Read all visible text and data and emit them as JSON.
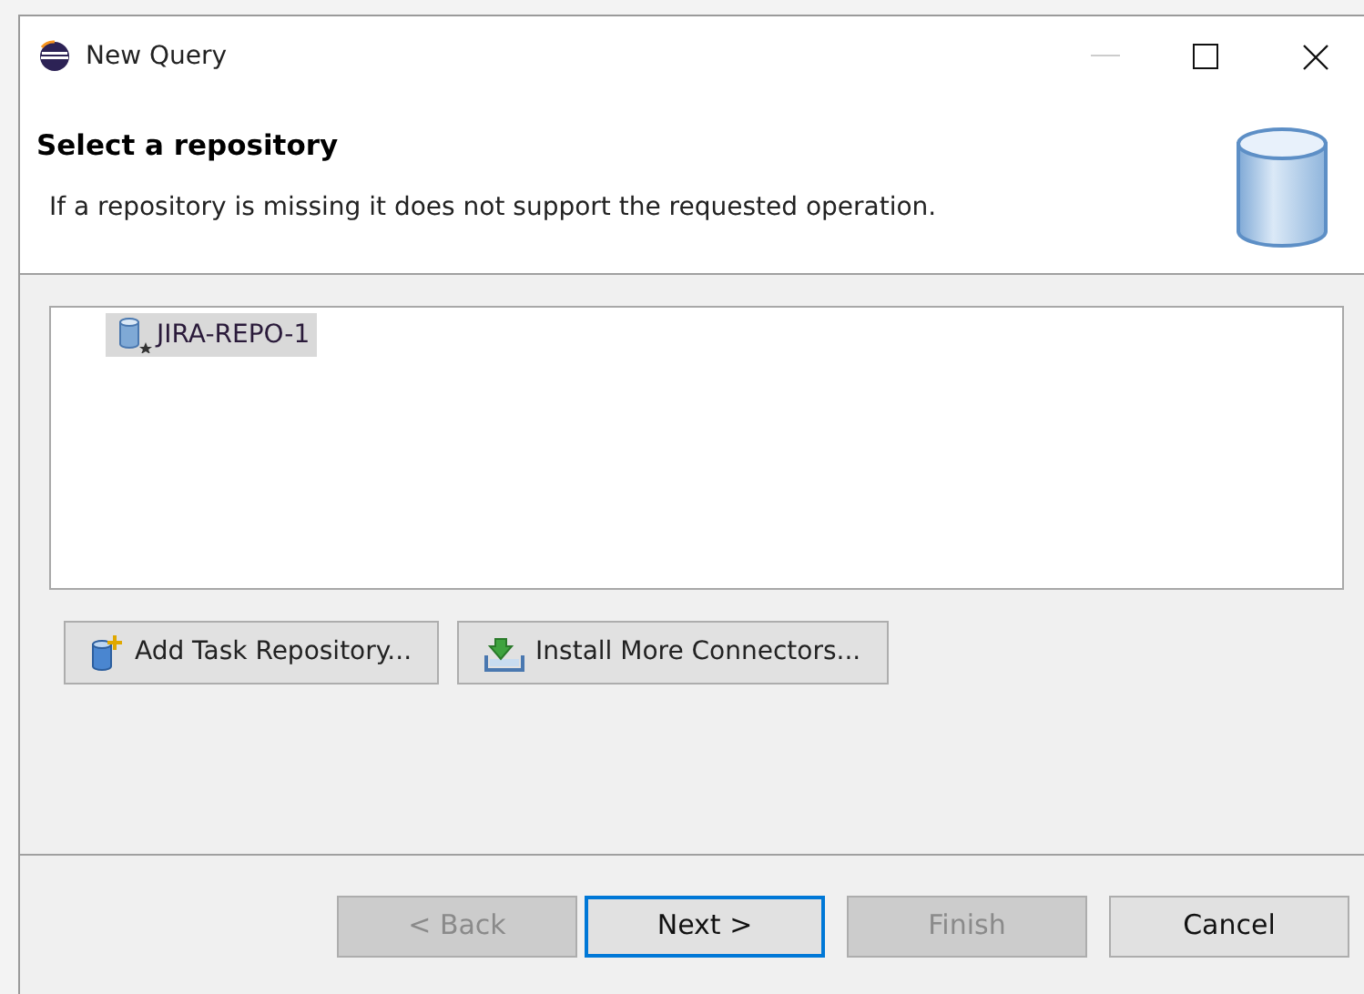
{
  "window": {
    "title": "New Query"
  },
  "header": {
    "title": "Select a repository",
    "description": "If a repository is missing it does not support the requested operation."
  },
  "repositories": [
    {
      "label": "JIRA-REPO-1",
      "selected": true
    }
  ],
  "actions": [
    {
      "label": "Add Task Repository...",
      "kind": "add"
    },
    {
      "label": "Install More Connectors...",
      "kind": "install"
    }
  ],
  "buttons": [
    {
      "label": "< Back",
      "disabled": true,
      "focused": false
    },
    {
      "label": "Next >",
      "disabled": false,
      "focused": true
    },
    {
      "label": "Finish",
      "disabled": true,
      "focused": false
    },
    {
      "label": "Cancel",
      "disabled": false,
      "focused": false
    }
  ]
}
